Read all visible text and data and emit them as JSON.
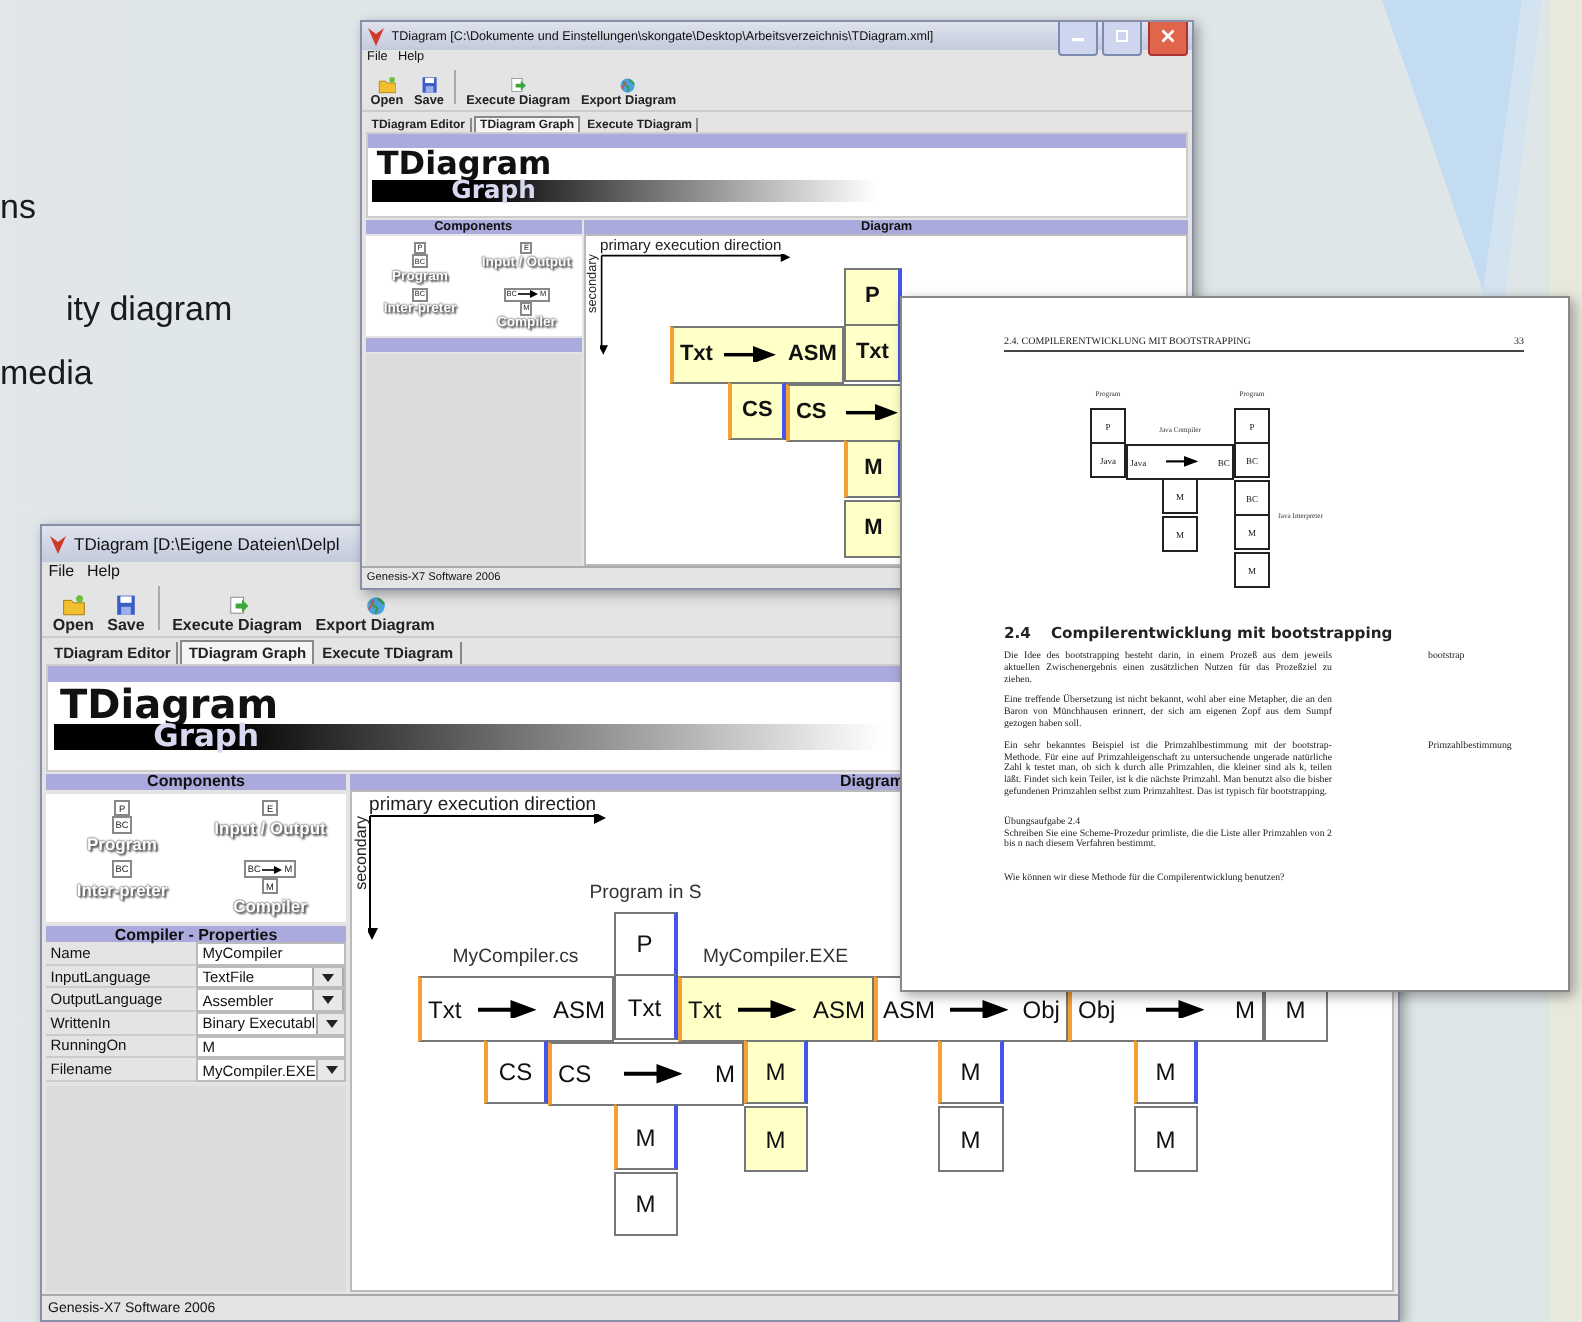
{
  "slide": {
    "text_lines": [
      "ns",
      "ity diagram",
      "media"
    ]
  },
  "windows": [
    {
      "title": "TDiagram [D:\\Eigene Dateien\\Delpl",
      "window_buttons": false,
      "menu": [
        "File",
        "Help"
      ],
      "toolbar": [
        {
          "kind": "open",
          "label": "Open"
        },
        {
          "kind": "save",
          "label": "Save"
        },
        {
          "kind": "execute",
          "label": "Execute Diagram"
        },
        {
          "kind": "export",
          "label": "Export Diagram"
        }
      ],
      "tabs": [
        {
          "label": "TDiagram Editor",
          "selected": false
        },
        {
          "label": "TDiagram Graph",
          "selected": true
        },
        {
          "label": "Execute TDiagram",
          "selected": false
        }
      ],
      "banner": {
        "title": "TDiagram",
        "subtitle": "Graph"
      },
      "components": {
        "title": "Components",
        "items": [
          {
            "kind": "program",
            "label": "Program",
            "parts": [
              "P",
              "BC"
            ]
          },
          {
            "kind": "io",
            "label": "Input / Output",
            "parts": [
              "E"
            ]
          },
          {
            "kind": "interpreter",
            "label": "Inter-preter",
            "parts": [
              "BC"
            ]
          },
          {
            "kind": "compiler",
            "label": "Compiler",
            "parts": [
              "BC",
              "M",
              "M"
            ]
          }
        ]
      },
      "properties": {
        "title": "Compiler - Properties",
        "rows": [
          {
            "name": "Name",
            "value": "MyCompiler",
            "dropdown": false
          },
          {
            "name": "InputLanguage",
            "value": "TextFile",
            "dropdown": true
          },
          {
            "name": "OutputLanguage",
            "value": "Assembler",
            "dropdown": true
          },
          {
            "name": "WrittenIn",
            "value": "Binary Executabl",
            "dropdown": true
          },
          {
            "name": "RunningOn",
            "value": "M",
            "dropdown": false
          },
          {
            "name": "Filename",
            "value": "MyCompiler.EXE",
            "dropdown": true
          }
        ]
      },
      "diagram": {
        "title": "Diagram",
        "axis_primary": "primary execution direction",
        "axis_secondary": "secondary",
        "pieces": [
          {
            "kind": "compiler",
            "title": "MyCompiler.cs",
            "source": "Txt",
            "target": "ASM",
            "language": "CS",
            "highlighted": false
          },
          {
            "kind": "program",
            "title": "Program in S",
            "name": "P",
            "language": "Txt",
            "highlighted": false
          },
          {
            "kind": "compiler",
            "source": "CS",
            "target": "M",
            "language": "M",
            "highlighted": false
          },
          {
            "kind": "machine",
            "name": "M",
            "highlighted": false
          },
          {
            "kind": "compiler",
            "title": "MyCompiler.EXE",
            "source": "Txt",
            "target": "ASM",
            "language": "M",
            "highlighted": true
          },
          {
            "kind": "machine",
            "name": "M",
            "highlighted": true
          },
          {
            "kind": "compiler",
            "source": "ASM",
            "target": "Obj",
            "language": "M",
            "highlighted": false
          },
          {
            "kind": "machine",
            "name": "M",
            "highlighted": false
          },
          {
            "kind": "compiler",
            "source": "Obj",
            "target": "M",
            "language": "M",
            "highlighted": false
          },
          {
            "kind": "machine",
            "name": "M",
            "highlighted": false
          },
          {
            "kind": "machine",
            "name": "M",
            "highlighted": false
          }
        ]
      },
      "status_bar": "Genesis-X7 Software 2006"
    },
    {
      "title": "TDiagram [C:\\Dokumente und Einstellungen\\skongate\\Desktop\\Arbeitsverzeichnis\\TDiagram.xml]",
      "window_buttons": true,
      "menu": [
        "File",
        "Help"
      ],
      "toolbar": [
        {
          "kind": "open",
          "label": "Open"
        },
        {
          "kind": "save",
          "label": "Save"
        },
        {
          "kind": "execute",
          "label": "Execute Diagram"
        },
        {
          "kind": "export",
          "label": "Export Diagram"
        }
      ],
      "tabs": [
        {
          "label": "TDiagram Editor",
          "selected": false
        },
        {
          "label": "TDiagram Graph",
          "selected": true
        },
        {
          "label": "Execute TDiagram",
          "selected": false
        }
      ],
      "banner": {
        "title": "TDiagram",
        "subtitle": "Graph"
      },
      "components": {
        "title": "Components",
        "items": [
          {
            "kind": "program",
            "label": "Program",
            "parts": [
              "P",
              "BC"
            ]
          },
          {
            "kind": "io",
            "label": "Input / Output",
            "parts": [
              "E"
            ]
          },
          {
            "kind": "interpreter",
            "label": "Inter-preter",
            "parts": [
              "BC"
            ]
          },
          {
            "kind": "compiler",
            "label": "Compiler",
            "parts": [
              "BC",
              "M",
              "M"
            ]
          }
        ]
      },
      "diagram": {
        "title": "Diagram",
        "axis_primary": "primary execution direction",
        "axis_secondary": "secondary",
        "pieces": [
          {
            "kind": "compiler",
            "source": "Txt",
            "target": "ASM",
            "language": "CS",
            "highlighted": true
          },
          {
            "kind": "program",
            "name": "P",
            "language": "Txt",
            "highlighted": true
          },
          {
            "kind": "compiler",
            "source": "CS",
            "language": "M",
            "highlighted": true
          },
          {
            "kind": "machine",
            "name": "M",
            "highlighted": true
          }
        ]
      },
      "status_bar": "Genesis-X7 Software 2006"
    }
  ],
  "document": {
    "header": "2.4. COMPILERENTWICKLUNG MIT BOOTSTRAPPING",
    "page_number": "33",
    "figure": {
      "pieces": [
        {
          "kind": "program",
          "title": "Program",
          "name": "P",
          "language": "Java",
          "highlighted": false
        },
        {
          "kind": "compiler",
          "title": "Java Compiler",
          "source": "Java",
          "target": "BC",
          "language": "M",
          "highlighted": false
        },
        {
          "kind": "machine",
          "name": "M",
          "highlighted": false
        },
        {
          "kind": "program",
          "title": "Program",
          "name": "P",
          "language": "BC",
          "highlighted": false
        },
        {
          "kind": "interpreter",
          "title": "Java Interpreter",
          "source": "BC",
          "language": "M",
          "highlighted": false
        },
        {
          "kind": "machine",
          "name": "M",
          "highlighted": false
        }
      ]
    },
    "section_number": "2.4",
    "section_title": "Compilerentwicklung mit bootstrapping",
    "paragraphs": [
      {
        "text": "Die Idee des bootstrapping besteht darin, in einem Prozeß aus dem jeweils aktuellen Zwischenergebnis einen zusätzlichen Nutzen für das Prozeßziel zu ziehen.",
        "margin_note": "bootstrap"
      },
      {
        "text": "Eine treffende Übersetzung ist nicht bekannt, wohl aber eine Metapher, die an den Baron von Münchhausen erinnert, der sich am eigenen Zopf aus dem Sumpf gezogen haben soll."
      },
      {
        "text": "Ein sehr bekanntes Beispiel ist die Primzahlbestimmung mit der bootstrap-Methode. Für eine auf Primzahleigenschaft zu untersuchende ungerade natürliche Zahl k testet man, ob sich k durch alle Primzahlen, die kleiner sind als k, teilen läßt. Findet sich kein Teiler, ist k die nächste Primzahl. Man benutzt also die bisher gefundenen Primzahlen selbst zum Primzahltest. Das ist typisch für bootstrapping.",
        "margin_note": "Primzahlbestimmung"
      }
    ],
    "exercise": {
      "title": "Übungsaufgabe 2.4",
      "text": "Schreiben Sie eine Scheme-Prozedur primliste, die die Liste aller Primzahlen von 2 bis n nach diesem Verfahren bestimmt."
    },
    "question": "Wie können wir diese Methode für die Compilerentwicklung benutzen?"
  }
}
